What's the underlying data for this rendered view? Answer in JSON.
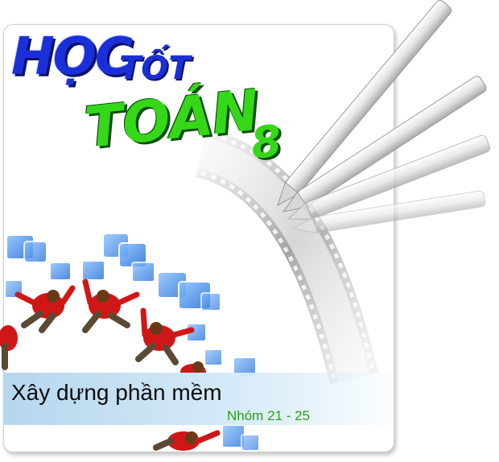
{
  "hero": {
    "title_line1": "HỌC",
    "title_line1_b": "TỐT",
    "title_line2": "TOÁN",
    "title_line2_b": "8"
  },
  "banner": {
    "title": "Xây dựng phần mềm",
    "subtitle": "Nhóm 21 - 25"
  },
  "colors": {
    "title_blue": "#1b2fd8",
    "title_green": "#35d819",
    "banner_blue": "#b6d6ee",
    "subtitle_green": "#2aa112"
  },
  "icons": [
    "pencil-icon",
    "film-strip-icon",
    "person-icon",
    "window-icon"
  ]
}
